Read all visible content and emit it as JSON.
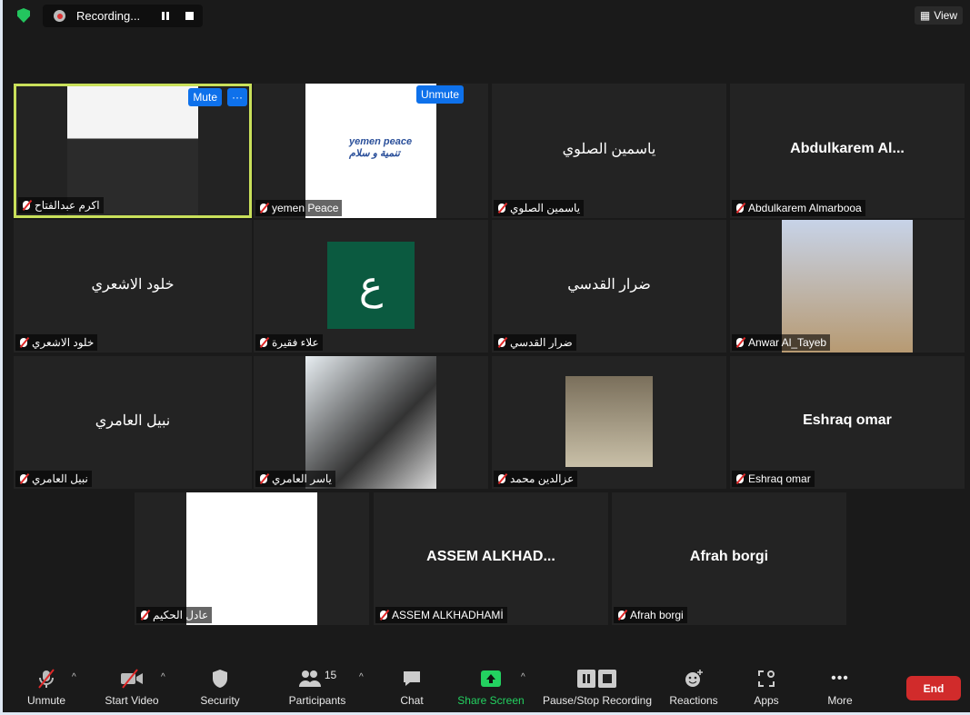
{
  "topbar": {
    "recording_label": "Recording...",
    "view_label": "View"
  },
  "tiles": [
    {
      "big": "",
      "name": "اكرم عبدالفتاح",
      "photo": true,
      "active": true,
      "buttons": [
        "Mute",
        "···"
      ]
    },
    {
      "big": "",
      "name": "yemen Peace",
      "photo": true,
      "logo_text": "yemen peace تنمية و سلام",
      "buttons": [
        "Unmute"
      ]
    },
    {
      "big": "ياسمين الصلوي",
      "name": "ياسمين الصلوي"
    },
    {
      "big": "Abdulkarem  Al...",
      "name": "Abdulkarem Almarbooa",
      "bold": true
    },
    {
      "big": "خلود الاشعري",
      "name": "خلود الاشعري"
    },
    {
      "big": "",
      "name": "علاء فقيرة",
      "avatar_letter": "ع"
    },
    {
      "big": "ضرار القدسي",
      "name": "ضرار القدسي"
    },
    {
      "big": "",
      "name": "Anwar Al_Tayeb",
      "photo": true
    },
    {
      "big": "نبيل العامري",
      "name": "نبيل العامري"
    },
    {
      "big": "",
      "name": "ياسر العامري",
      "photo": true
    },
    {
      "big": "",
      "name": "عزالدين محمد",
      "photo": true,
      "small_photo": true
    },
    {
      "big": "Eshraq omar",
      "name": "Eshraq omar",
      "bold": true
    },
    {
      "big": "",
      "name": "عادل الحكيم",
      "photo": true
    },
    {
      "big": "ASSEM  ALKHAD...",
      "name": "ASSEM ALKHADHAMİ",
      "bold": true
    },
    {
      "big": "Afrah borgi",
      "name": "Afrah borgi",
      "bold": true
    }
  ],
  "toolbar": {
    "unmute": "Unmute",
    "start_video": "Start Video",
    "security": "Security",
    "participants": "Participants",
    "participants_count": "15",
    "chat": "Chat",
    "share_screen": "Share Screen",
    "recording": "Pause/Stop Recording",
    "reactions": "Reactions",
    "apps": "Apps",
    "more": "More",
    "end": "End"
  },
  "colors": {
    "accent": "#0e71eb",
    "active_border": "#c9e05a",
    "share": "#23d160",
    "end": "#d12b2b"
  }
}
